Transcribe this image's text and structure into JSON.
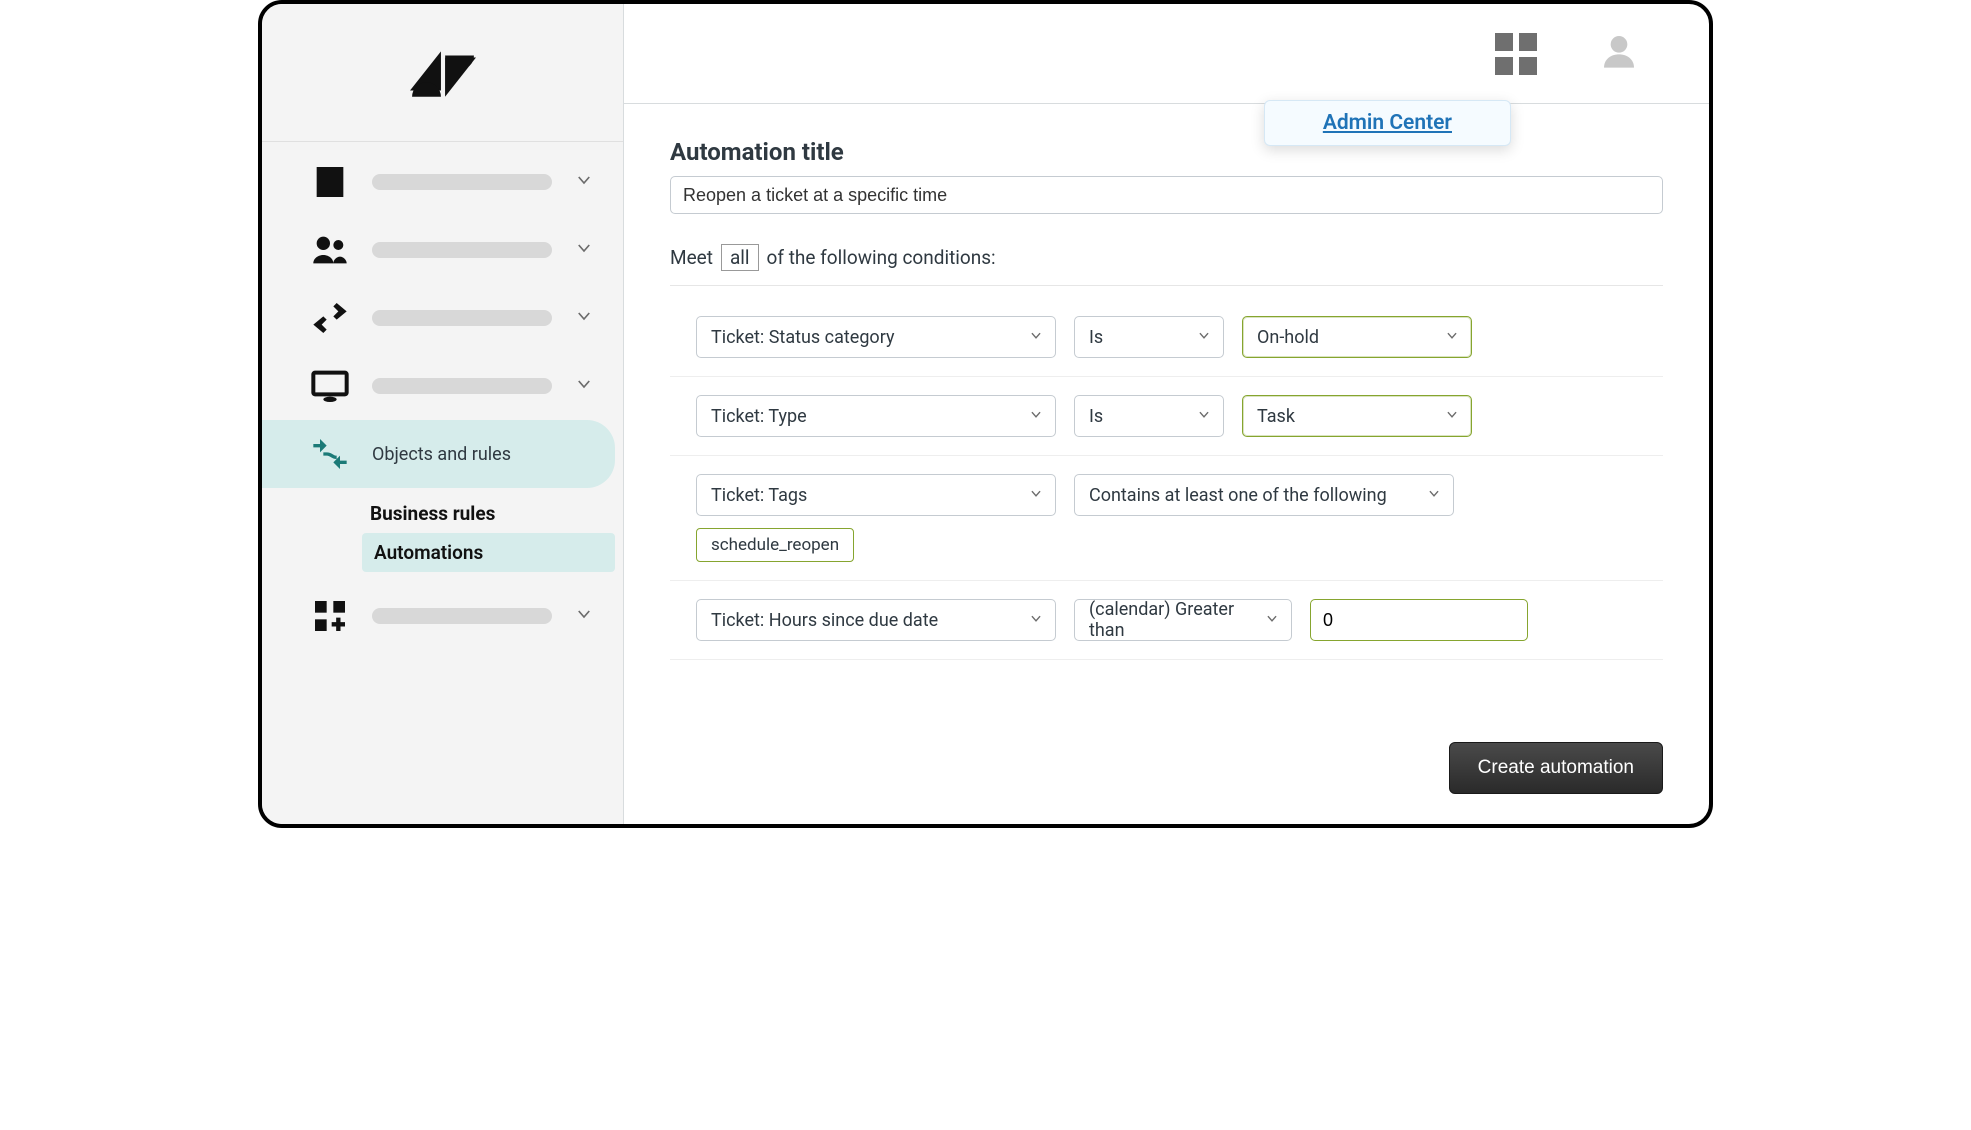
{
  "header": {
    "tooltip_label": "Admin Center"
  },
  "sidebar": {
    "active_label": "Objects and rules",
    "sub": {
      "business_rules": "Business rules",
      "automations": "Automations"
    }
  },
  "main": {
    "section_title": "Automation title",
    "title_value": "Reopen a ticket at a specific time",
    "meet_pre": "Meet",
    "meet_all": "all",
    "meet_post": "of the following conditions:",
    "conditions": [
      {
        "field": "Ticket: Status category",
        "op": "Is",
        "value": "On-hold"
      },
      {
        "field": "Ticket: Type",
        "op": "Is",
        "value": "Task"
      },
      {
        "field": "Ticket: Tags",
        "op": "Contains at least one of the following",
        "tag": "schedule_reopen"
      },
      {
        "field": "Ticket: Hours since due date",
        "op": "(calendar) Greater than",
        "value": "0"
      }
    ],
    "create_label": "Create automation"
  }
}
